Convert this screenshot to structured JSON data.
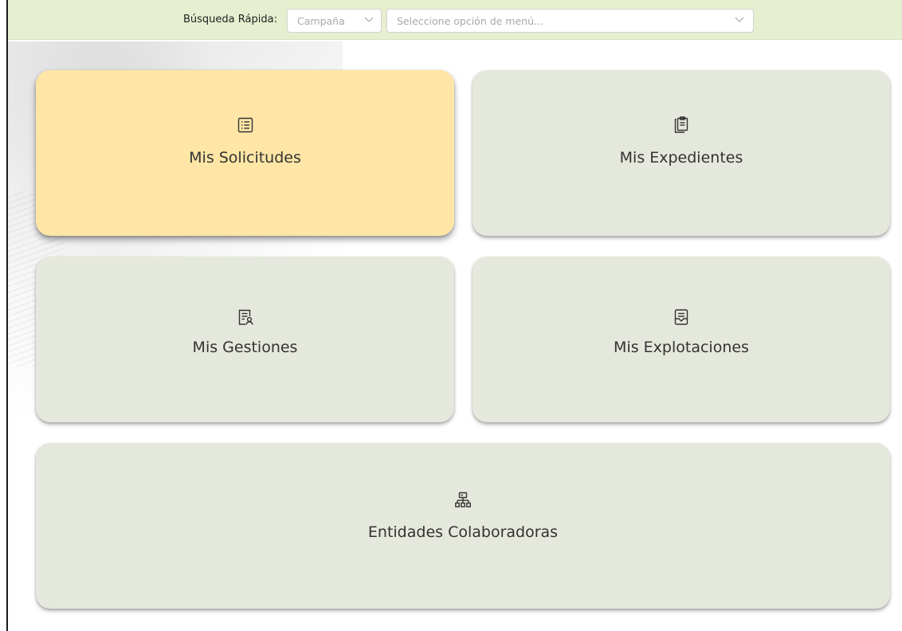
{
  "quick_search": {
    "label": "Búsqueda Rápida:",
    "campaign_value": "Campaña",
    "menu_placeholder": "Seleccione opción de menú..."
  },
  "tiles": [
    {
      "label": "Mis Solicitudes",
      "icon": "list-icon",
      "active": true
    },
    {
      "label": "Mis Expedientes",
      "icon": "clipboard-icon",
      "active": false
    },
    {
      "label": "Mis Gestiones",
      "icon": "document-user-icon",
      "active": false
    },
    {
      "label": "Mis Explotaciones",
      "icon": "document-inbox-icon",
      "active": false
    },
    {
      "label": "Entidades Colaboradoras",
      "icon": "org-chart-icon",
      "active": false
    }
  ],
  "colors": {
    "topbar_bg": "#e6efcf",
    "tile_bg": "#e5e8dc",
    "tile_active_bg": "#ffe6a6"
  }
}
